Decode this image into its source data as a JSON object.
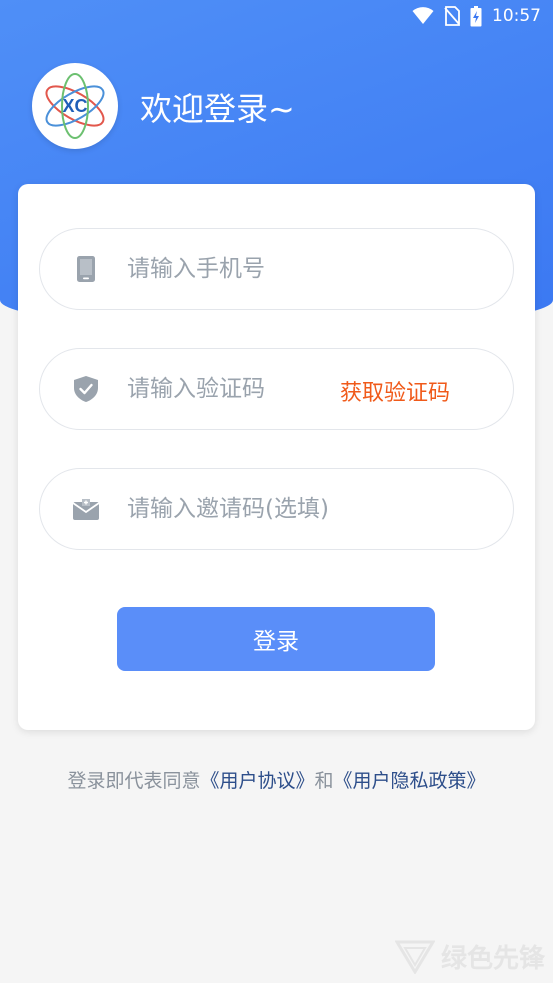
{
  "status_bar": {
    "time": "10:57"
  },
  "header": {
    "welcome": "欢迎登录~",
    "logo_text": "XC"
  },
  "form": {
    "phone_placeholder": "请输入手机号",
    "code_placeholder": "请输入验证码",
    "get_code_label": "获取验证码",
    "invite_placeholder": "请输入邀请码(选填)",
    "login_label": "登录"
  },
  "agreement": {
    "prefix": "登录即代表同意",
    "user_agreement": "《用户协议》",
    "and": "和",
    "privacy_policy": "《用户隐私政策》"
  },
  "watermark": {
    "text": "绿色先锋"
  },
  "colors": {
    "header_blue": "#3b78f2",
    "button_blue": "#5a8ef9",
    "get_code_orange": "#f05a1a",
    "link_blue": "#2d4e8a",
    "icon_gray": "#9aa3ad"
  }
}
